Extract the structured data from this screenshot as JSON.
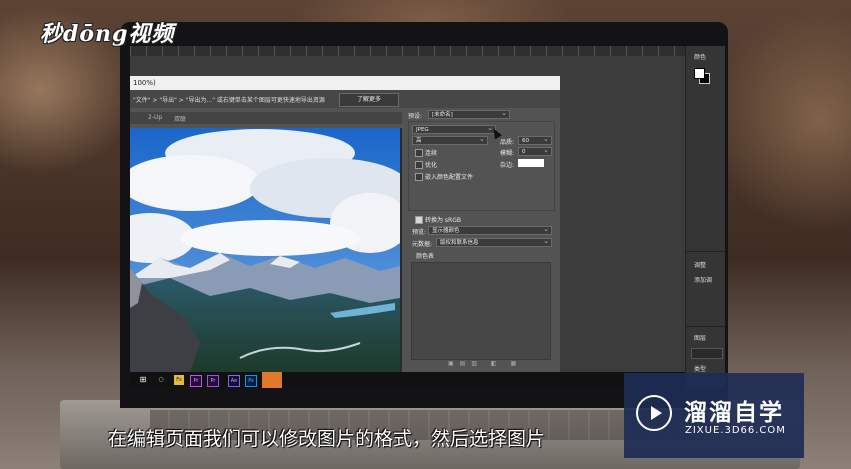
{
  "watermark_logo": "秒dōng视频",
  "subtitle": "在编辑页面我们可以修改图片的格式，然后选择图片",
  "brand": {
    "name": "溜溜自学",
    "url": "ZIXUE.3D66.COM"
  },
  "dialog": {
    "title": "100%)",
    "tip": "\"文件\" > \"导出\" > \"导出为...\" 或右键单击某个图层可更快速地导出资源",
    "learn_more": "了解更多",
    "tabs": [
      "2-Up",
      "双联"
    ],
    "preset_label": "预设:",
    "preset_value": "[未命名]",
    "format_value": "JPEG",
    "quality_preset_value": "高",
    "quality_label": "品质:",
    "quality_value": "60",
    "progressive_label": "连续",
    "blur_label": "模糊:",
    "blur_value": "0",
    "optimized_label": "优化",
    "matte_label": "杂边:",
    "icc_label": "嵌入颜色配置文件",
    "convert_srgb_label": "转换为 sRGB",
    "preview_label": "预览:",
    "preview_value": "显示器颜色",
    "metadata_label": "元数据:",
    "metadata_value": "版权和联系信息",
    "color_table_label": "颜色表"
  },
  "right_panels": {
    "color": "颜色",
    "adjust": "调整",
    "add_adjust": "添加调",
    "layers": "图层",
    "kind": "类型"
  },
  "taskbar": {
    "win": "⊞",
    "circle": "○",
    "fs": "Fs",
    "pr": "Pr",
    "ae": "Ae",
    "ps": "Ps"
  },
  "colors": {
    "accent_taskbar": "#e07a2a",
    "brand_bg": "#1e2d55"
  }
}
